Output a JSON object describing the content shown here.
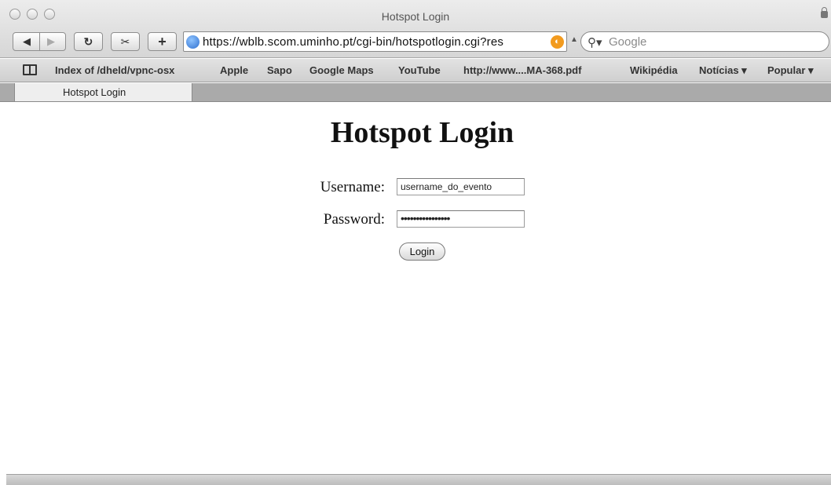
{
  "window": {
    "title": "Hotspot Login"
  },
  "toolbar": {
    "back_icon": "back-arrow-icon",
    "forward_icon": "forward-arrow-icon",
    "reload_icon": "reload-icon",
    "snippet_icon": "webclip-scissors-icon",
    "add_icon": "plus-icon",
    "address": "https://wblb.scom.uminho.pt/cgi-bin/hotspotlogin.cgi?res",
    "search_placeholder": "Google"
  },
  "bookmarks": {
    "items": [
      "Index of /dheld/vpnc-osx",
      "Apple",
      "Sapo",
      "Google Maps",
      "YouTube",
      "http://www....MA-368.pdf",
      "Wikipédia",
      "Notícias ▾",
      "Popular ▾"
    ]
  },
  "tabs": [
    {
      "label": "Hotspot Login"
    }
  ],
  "page": {
    "heading": "Hotspot Login",
    "username_label": "Username:",
    "username_value": "username_do_evento",
    "password_label": "Password:",
    "password_value": "••••••••••••••••",
    "login_button": "Login"
  },
  "colors": {
    "rss_orange": "#f29b1f",
    "globe_blue": "#2e6fcf"
  }
}
